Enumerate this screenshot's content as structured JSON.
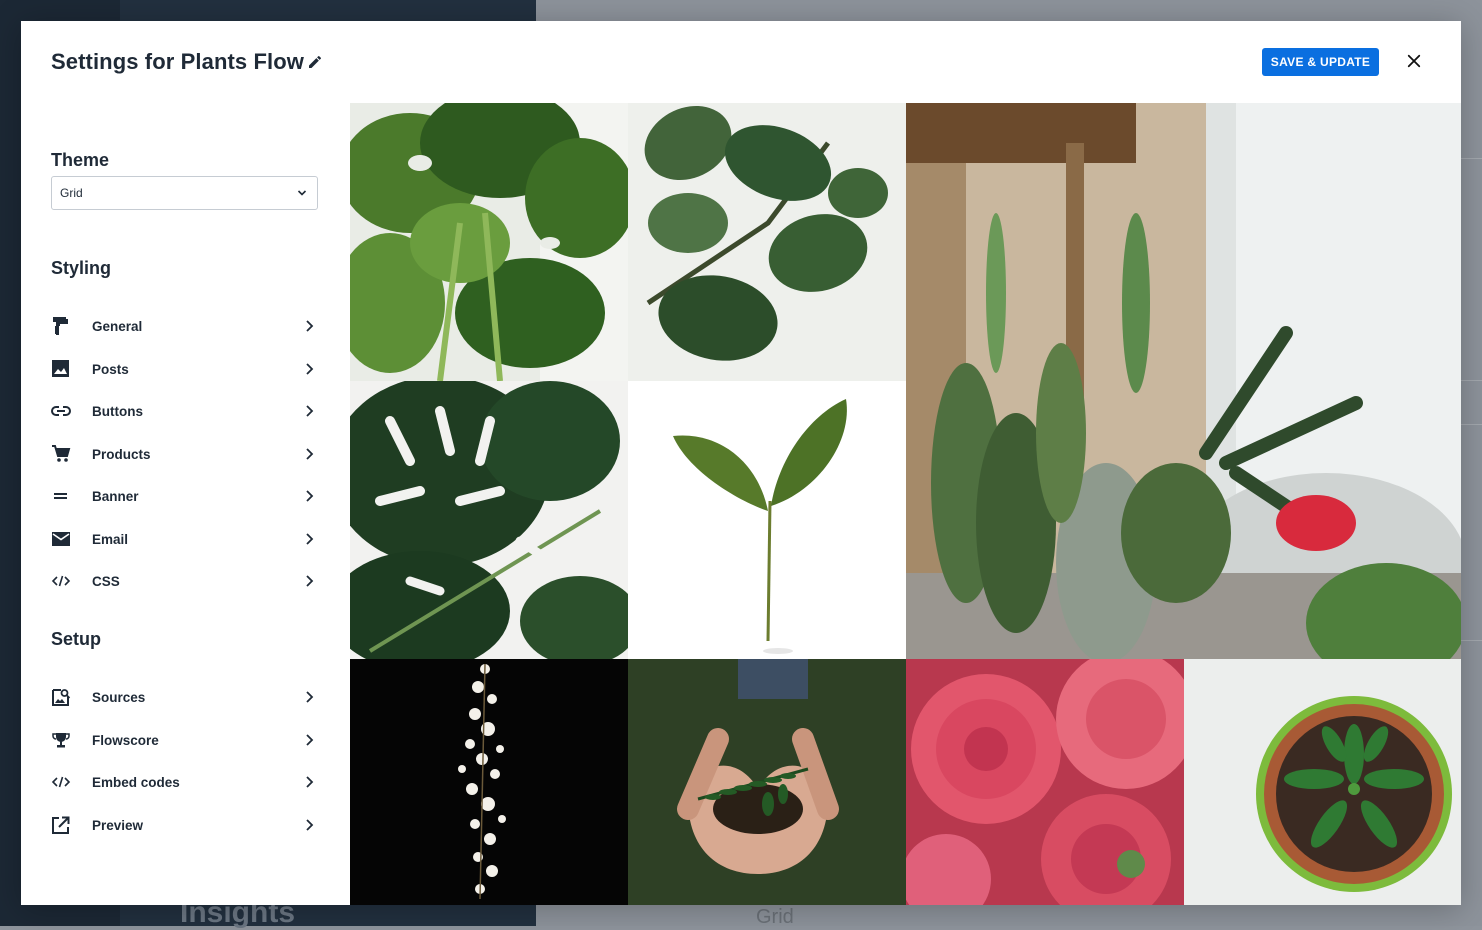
{
  "background": {
    "left_heading": "Insights",
    "right_label": "Grid"
  },
  "modal": {
    "title": "Settings for Plants Flow",
    "save_label": "SAVE & UPDATE",
    "accent_color": "#0a6fe0"
  },
  "sidebar": {
    "theme_heading": "Theme",
    "theme_value": "Grid",
    "styling_heading": "Styling",
    "styling_items": [
      {
        "label": "General",
        "icon": "paint-roller-icon"
      },
      {
        "label": "Posts",
        "icon": "image-icon"
      },
      {
        "label": "Buttons",
        "icon": "link-icon"
      },
      {
        "label": "Products",
        "icon": "cart-icon"
      },
      {
        "label": "Banner",
        "icon": "equals-icon"
      },
      {
        "label": "Email",
        "icon": "mail-icon"
      },
      {
        "label": "CSS",
        "icon": "code-icon"
      }
    ],
    "setup_heading": "Setup",
    "setup_items": [
      {
        "label": "Sources",
        "icon": "image-search-icon"
      },
      {
        "label": "Flowscore",
        "icon": "trophy-icon"
      },
      {
        "label": "Embed codes",
        "icon": "code-icon"
      },
      {
        "label": "Preview",
        "icon": "open-external-icon"
      }
    ]
  },
  "grid": {
    "tiles": [
      {
        "subject": "monstera-leaves"
      },
      {
        "subject": "fiddle-leaf-fig"
      },
      {
        "subject": "cacti-by-window"
      },
      {
        "subject": "monstera-leaf-closeup"
      },
      {
        "subject": "single-sprout"
      },
      {
        "subject": "white-blossoms-on-black"
      },
      {
        "subject": "hands-holding-soil-and-fern"
      },
      {
        "subject": "pink-dahlias"
      },
      {
        "subject": "potted-seedling-top-view"
      }
    ]
  }
}
